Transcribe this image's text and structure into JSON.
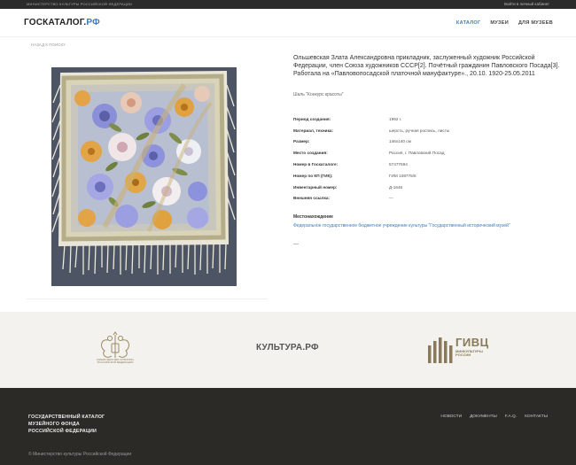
{
  "topbar": {
    "ministry": "МИНИСТЕРСТВО КУЛЬТУРЫ РОССИЙСКОЙ ФЕДЕРАЦИИ",
    "login": "Войти в личный кабинет"
  },
  "header": {
    "logo_main": "ГОСКАТАЛОГ.",
    "logo_rf": "РФ",
    "nav": [
      "КАТАЛОГ",
      "МУЗЕИ",
      "ДЛЯ МУЗЕЕВ"
    ]
  },
  "back_link": "НАЗАД К ПОИСКУ",
  "item": {
    "title": "Ольшевская Злата Александровна прикладник, заслуженный художник Российской Федерации, член Союза художников СССР[2]. Почётный гражданин Павловского Посада[3]. Работала на «Павловопосадской платочной мануфактуре»., 20.10. 1920-25.05.2011",
    "subtitle": "Шаль \"Конкурс красоты\"",
    "props": [
      {
        "k": "Период создания:",
        "v": "1992 г."
      },
      {
        "k": "Материал, техника:",
        "v": "шерсть, ручная роспись, листы"
      },
      {
        "k": "Размер:",
        "v": "146х140 см"
      },
      {
        "k": "Место создания:",
        "v": "Россия, г. Павловский Посад"
      },
      {
        "k": "Номер в Госкаталоге:",
        "v": "57477694"
      },
      {
        "k": "Номер по КП (ГИК):",
        "v": "ГИМ 108775/6"
      },
      {
        "k": "Инвентарный номер:",
        "v": "Д-1646"
      },
      {
        "k": "Внешняя ссылка:",
        "v": "—"
      }
    ],
    "location_label": "Местонахождение",
    "location_link": "Федеральное государственное бюджетное учреждение культуры \"Государственный исторический музей\"",
    "dash": "—"
  },
  "partners": {
    "emblem_text": "МИНИСТЕРСТВО КУЛЬТУРЫ РОССИЙСКОЙ ФЕДЕРАЦИИ",
    "kultura": "КУЛЬТУРА.РФ",
    "givc_name": "ГИВЦ",
    "givc_sub_1": "МИНКУЛЬТУРЫ",
    "givc_sub_2": "РОССИИ"
  },
  "footer": {
    "title_1": "ГОСУДАРСТВЕННЫЙ КАТАЛОГ",
    "title_2": "МУЗЕЙНОГО ФОНДА",
    "title_3": "РОССИЙСКОЙ ФЕДЕРАЦИИ",
    "nav": [
      "НОВОСТИ",
      "ДОКУМЕНТЫ",
      "F.A.Q.",
      "КОНТАКТЫ"
    ],
    "copyright": "© Министерство культуры Российской Федерации"
  },
  "colors": {
    "accent": "#3a7bbf",
    "dark_bar": "#2b2b2b",
    "footer_bg": "#2b2a27",
    "partners_bg": "#f3f2ee",
    "gold": "#8a7a5a"
  }
}
